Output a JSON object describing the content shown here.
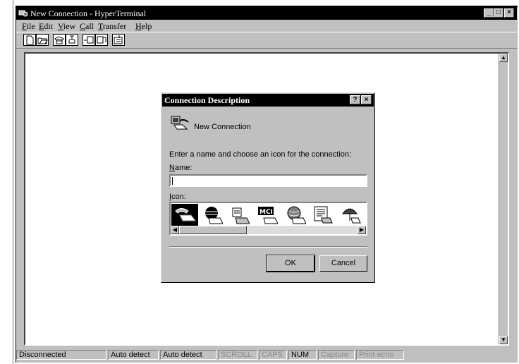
{
  "window": {
    "title": "New Connection - HyperTerminal",
    "caption_buttons": [
      "_",
      "□",
      "×"
    ]
  },
  "menu": {
    "items": [
      {
        "label": "File",
        "accel": "F",
        "rest": "ile"
      },
      {
        "label": "Edit",
        "accel": "E",
        "rest": "dit"
      },
      {
        "label": "View",
        "accel": "V",
        "rest": "iew"
      },
      {
        "label": "Call",
        "accel": "C",
        "rest": "all"
      },
      {
        "label": "Transfer",
        "accel": "T",
        "rest": "ransfer"
      },
      {
        "label": "Help",
        "accel": "H",
        "rest": "elp"
      }
    ]
  },
  "toolbar": {
    "icons": [
      "new-document-icon",
      "open-folder-icon",
      "call-icon",
      "disconnect-icon",
      "send-icon",
      "receive-icon",
      "properties-icon"
    ]
  },
  "dialog": {
    "title": "Connection Description",
    "help_button": "?",
    "close_button": "×",
    "connection_name": "New Connection",
    "prompt": "Enter a name and choose an icon for the connection:",
    "name_label_accel": "N",
    "name_label_rest": "ame:",
    "name_value": "",
    "icon_label_accel": "I",
    "icon_label_rest": "con:",
    "icons": [
      "phone-computer-icon",
      "globe-computer-icon",
      "fax-computer-icon",
      "mci-computer-icon",
      "att-computer-icon",
      "document-computer-icon",
      "umbrella-computer-icon"
    ],
    "ok_label": "OK",
    "cancel_label": "Cancel"
  },
  "statusbar": {
    "connection": "Disconnected",
    "detect1": "Auto detect",
    "detect2": "Auto detect",
    "scroll": "SCROLL",
    "caps": "CAPS",
    "num": "NUM",
    "capture": "Capture",
    "print_echo": "Print echo"
  },
  "colors": {
    "titlebar": "#000000",
    "face": "#c0c0c0",
    "client": "#ffffff"
  }
}
